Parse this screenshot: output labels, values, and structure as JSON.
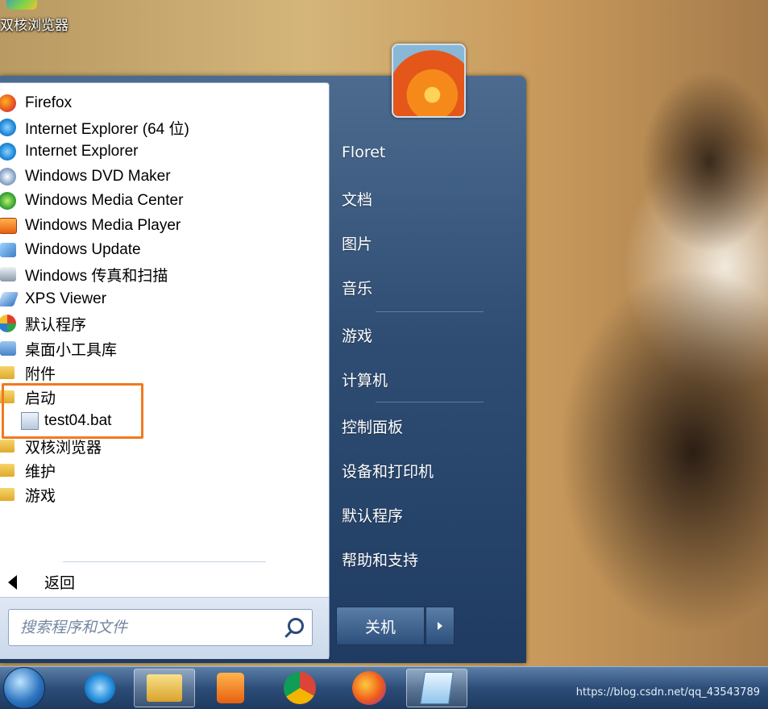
{
  "desktop": {
    "icon_label": "双核浏览器"
  },
  "programs": [
    {
      "label": "Firefox",
      "icon": "firefox-icon",
      "color": "#e8701a"
    },
    {
      "label": "Internet Explorer (64 位)",
      "icon": "ie-icon",
      "color": "#1e88d8"
    },
    {
      "label": "Internet Explorer",
      "icon": "ie-icon",
      "color": "#1e88d8"
    },
    {
      "label": "Windows DVD Maker",
      "icon": "dvd-maker-icon",
      "color": "#6f8fb8"
    },
    {
      "label": "Windows Media Center",
      "icon": "media-center-icon",
      "color": "#3aa636"
    },
    {
      "label": "Windows Media Player",
      "icon": "media-player-icon",
      "color": "#f08a18"
    },
    {
      "label": "Windows Update",
      "icon": "windows-update-icon",
      "color": "#3c7dc8"
    },
    {
      "label": "Windows 传真和扫描",
      "icon": "fax-scan-icon",
      "color": "#8a9aaa"
    },
    {
      "label": "XPS Viewer",
      "icon": "xps-viewer-icon",
      "color": "#3b78c4"
    },
    {
      "label": "默认程序",
      "icon": "default-programs-icon",
      "color": "#2fa24a"
    },
    {
      "label": "桌面小工具库",
      "icon": "gadgets-icon",
      "color": "#4a82c6"
    },
    {
      "label": "附件",
      "icon": "folder-icon",
      "color": "#e8b431"
    },
    {
      "label": "启动",
      "icon": "folder-icon",
      "color": "#e8b431"
    },
    {
      "label": "test04.bat",
      "icon": "bat-file-icon",
      "color": "#b9c9de"
    },
    {
      "label": "双核浏览器",
      "icon": "folder-icon",
      "color": "#e8b431"
    },
    {
      "label": "维护",
      "icon": "folder-icon",
      "color": "#e8b431"
    },
    {
      "label": "游戏",
      "icon": "folder-icon",
      "color": "#e8b431"
    }
  ],
  "back_label": "返回",
  "search": {
    "placeholder": "搜索程序和文件"
  },
  "right_pane": {
    "items": [
      "Floret",
      "文档",
      "图片",
      "音乐",
      "游戏",
      "计算机",
      "控制面板",
      "设备和打印机",
      "默认程序",
      "帮助和支持"
    ]
  },
  "shutdown_label": "关机",
  "taskbar": {
    "apps": [
      "start-orb",
      "internet-explorer",
      "windows-explorer",
      "media-player",
      "chrome",
      "firefox",
      "notepad"
    ],
    "url_text": "https://blog.csdn.net/qq_43543789"
  },
  "colors": {
    "highlight": "#f07a1e",
    "menu_blue": "#2f4d73"
  }
}
